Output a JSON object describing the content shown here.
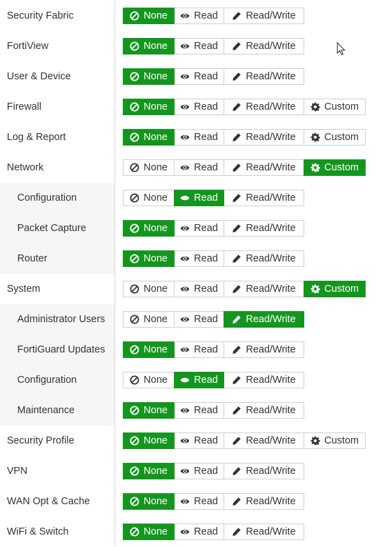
{
  "options": {
    "none": "None",
    "read": "Read",
    "read_write": "Read/Write",
    "custom": "Custom"
  },
  "colors": {
    "active": "#14961e"
  },
  "icons": {
    "none": "ban-icon",
    "read": "eye-icon",
    "read_write": "pencil-icon",
    "custom": "gear-icon"
  },
  "rows": [
    {
      "label": "Security Fabric",
      "sub": false,
      "custom": false,
      "selected": "none"
    },
    {
      "label": "FortiView",
      "sub": false,
      "custom": false,
      "selected": "none"
    },
    {
      "label": "User & Device",
      "sub": false,
      "custom": false,
      "selected": "none"
    },
    {
      "label": "Firewall",
      "sub": false,
      "custom": true,
      "selected": "none"
    },
    {
      "label": "Log & Report",
      "sub": false,
      "custom": true,
      "selected": "none"
    },
    {
      "label": "Network",
      "sub": false,
      "custom": true,
      "selected": "custom"
    },
    {
      "label": "Configuration",
      "sub": true,
      "custom": false,
      "selected": "read"
    },
    {
      "label": "Packet Capture",
      "sub": true,
      "custom": false,
      "selected": "none"
    },
    {
      "label": "Router",
      "sub": true,
      "custom": false,
      "selected": "none"
    },
    {
      "label": "System",
      "sub": false,
      "custom": true,
      "selected": "custom"
    },
    {
      "label": "Administrator Users",
      "sub": true,
      "custom": false,
      "selected": "read_write"
    },
    {
      "label": "FortiGuard Updates",
      "sub": true,
      "custom": false,
      "selected": "none"
    },
    {
      "label": "Configuration",
      "sub": true,
      "custom": false,
      "selected": "read"
    },
    {
      "label": "Maintenance",
      "sub": true,
      "custom": false,
      "selected": "none"
    },
    {
      "label": "Security Profile",
      "sub": false,
      "custom": true,
      "selected": "none"
    },
    {
      "label": "VPN",
      "sub": false,
      "custom": false,
      "selected": "none"
    },
    {
      "label": "WAN Opt & Cache",
      "sub": false,
      "custom": false,
      "selected": "none"
    },
    {
      "label": "WiFi & Switch",
      "sub": false,
      "custom": false,
      "selected": "none"
    }
  ]
}
